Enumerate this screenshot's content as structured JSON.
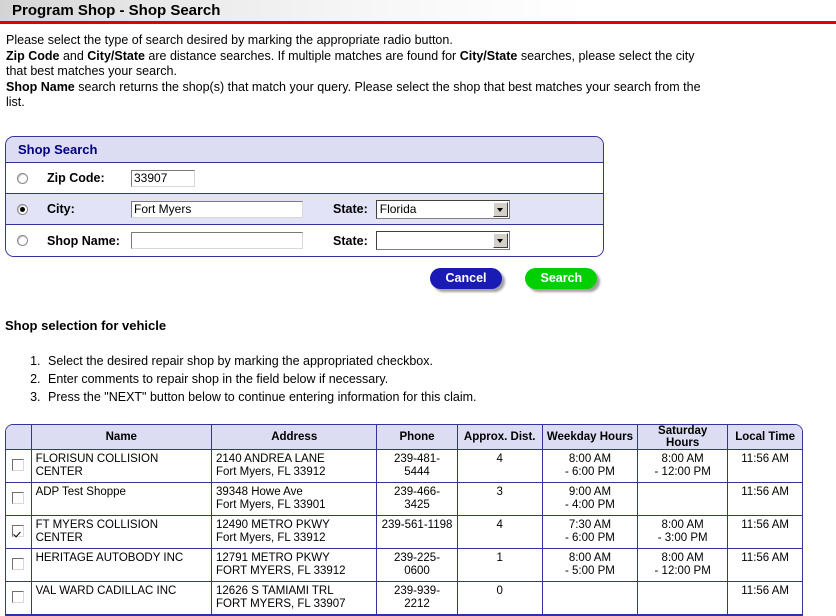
{
  "page": {
    "title": "Program Shop - Shop Search"
  },
  "intro": {
    "line1": "Please select the type of search desired by marking the appropriate radio button.",
    "line2_b1": "Zip Code",
    "line2_mid1": " and ",
    "line2_b2": "City/State",
    "line2_mid2": " are distance searches. If multiple matches are found for ",
    "line2_b3": "City/State",
    "line2_end": " searches, please select the city that best matches your search.",
    "line3_b1": "Shop Name",
    "line3_end": " search returns the shop(s) that match your query. Please select the shop that best matches your search from the list."
  },
  "search_panel": {
    "header": "Shop Search",
    "zip": {
      "label": "Zip Code:",
      "value": "33907",
      "selected": false
    },
    "city": {
      "label": "City:",
      "value": "Fort Myers",
      "selected": true,
      "state_label": "State:",
      "state_value": "Florida"
    },
    "shop_name": {
      "label": "Shop Name:",
      "value": "",
      "selected": false,
      "state_label": "State:",
      "state_value": ""
    }
  },
  "buttons": {
    "cancel": "Cancel",
    "search": "Search"
  },
  "selection": {
    "title": "Shop selection for vehicle",
    "steps": [
      "Select the desired repair shop by marking the appropriated checkbox.",
      "Enter comments to repair shop in the field below if necessary.",
      "Press the \"NEXT\" button below to continue entering information for this claim."
    ]
  },
  "results_table": {
    "columns": [
      "",
      "Name",
      "Address",
      "Phone",
      "Approx. Dist.",
      "Weekday  Hours",
      "Saturday Hours",
      "Local Time"
    ],
    "rows": [
      {
        "checked": false,
        "name": "FLORISUN COLLISION CENTER",
        "address1": "2140 ANDREA LANE",
        "address2": "Fort Myers, FL 33912",
        "phone": "239-481-5444",
        "distance": "4",
        "weekday_open": "8:00 AM",
        "weekday_close": "- 6:00 PM",
        "saturday_open": "8:00 AM",
        "saturday_close": "- 12:00 PM",
        "local_time": "11:56 AM"
      },
      {
        "checked": false,
        "name": "ADP Test Shoppe",
        "address1": "39348 Howe Ave",
        "address2": "Fort Myers, FL 33901",
        "phone": "239-466-3425",
        "distance": "3",
        "weekday_open": "9:00 AM",
        "weekday_close": "- 4:00 PM",
        "saturday_open": "",
        "saturday_close": "",
        "local_time": "11:56 AM"
      },
      {
        "checked": true,
        "name": "FT MYERS COLLISION CENTER",
        "address1": "12490 METRO PKWY",
        "address2": "Fort Myers, FL 33912",
        "phone": "239-561-1198",
        "distance": "4",
        "weekday_open": "7:30 AM",
        "weekday_close": "- 6:00 PM",
        "saturday_open": "8:00 AM",
        "saturday_close": "- 3:00 PM",
        "local_time": "11:56 AM"
      },
      {
        "checked": false,
        "name": "HERITAGE AUTOBODY INC",
        "address1": "12791 METRO PKWY",
        "address2": "FORT MYERS, FL 33912",
        "phone": "239-225-0600",
        "distance": "1",
        "weekday_open": "8:00 AM",
        "weekday_close": "- 5:00 PM",
        "saturday_open": "8:00 AM",
        "saturday_close": "- 12:00 PM",
        "local_time": "11:56 AM"
      },
      {
        "checked": false,
        "name": "VAL WARD CADILLAC INC",
        "address1": "12626 S TAMIAMI TRL",
        "address2": "FORT MYERS, FL 33907",
        "phone": "239-939-2212",
        "distance": "0",
        "weekday_open": "",
        "weekday_close": "",
        "saturday_open": "",
        "saturday_close": "",
        "local_time": "11:56 AM"
      }
    ]
  }
}
